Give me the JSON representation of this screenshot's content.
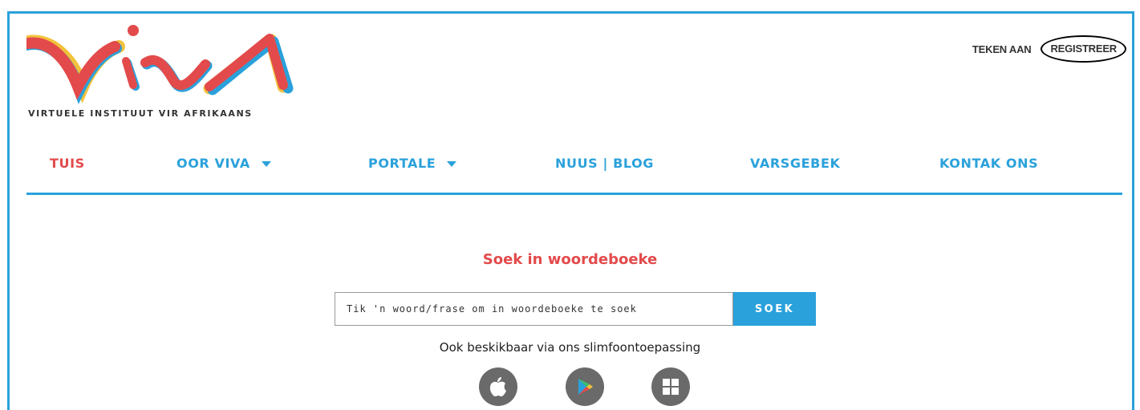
{
  "logo": {
    "text": "VIVA",
    "tagline": "VIRTUELE INSTITUUT VIR AFRIKAANS"
  },
  "top_links": {
    "login": "TEKEN AAN",
    "register": "REGISTREER"
  },
  "nav": {
    "items": [
      {
        "label": "TUIS",
        "active": true,
        "dropdown": false
      },
      {
        "label": "OOR VIVA",
        "active": false,
        "dropdown": true
      },
      {
        "label": "PORTALE",
        "active": false,
        "dropdown": true
      },
      {
        "label": "NUUS | BLOG",
        "active": false,
        "dropdown": false
      },
      {
        "label": "VARSGEBEK",
        "active": false,
        "dropdown": false
      },
      {
        "label": "KONTAK ONS",
        "active": false,
        "dropdown": false
      }
    ]
  },
  "search": {
    "title": "Soek in woordeboeke",
    "placeholder": "Tik 'n woord/frase om in woordeboeke te soek",
    "button": "SOEK"
  },
  "apps": {
    "text": "Ook beskikbaar via ons slimfoontoepassing",
    "icons": [
      "apple-icon",
      "google-play-icon",
      "windows-icon"
    ]
  },
  "colors": {
    "accent_blue": "#2aa1db",
    "accent_red": "#e34a4b",
    "icon_grey": "#6a6a6a"
  }
}
